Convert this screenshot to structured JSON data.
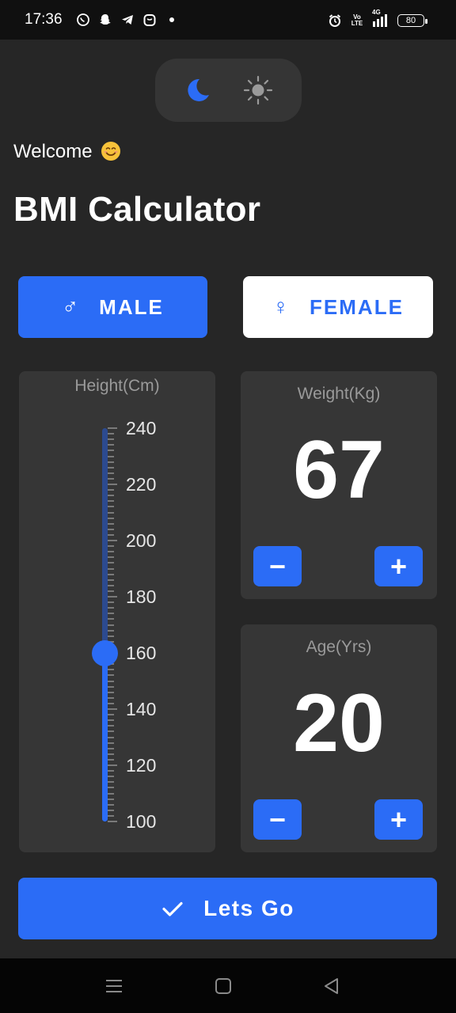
{
  "status_bar": {
    "time": "17:36",
    "left_icons": [
      "whatsapp-icon",
      "snapchat-icon",
      "telegram-icon",
      "bag-icon",
      "dot-icon"
    ],
    "volte": "Vo LTE",
    "network": "4G",
    "battery": "80"
  },
  "theme_toggle": {
    "moon_icon": "moon-icon",
    "sun_icon": "sun-icon",
    "active": "dark"
  },
  "welcome": "Welcome",
  "title": "BMI Calculator",
  "gender": {
    "male_label": "MALE",
    "female_label": "FEMALE",
    "male_symbol": "♂",
    "female_symbol": "♀",
    "selected": "male"
  },
  "height": {
    "label": "Height(Cm)",
    "min": 100,
    "max": 240,
    "value": 160,
    "tick_labels": [
      "240",
      "220",
      "200",
      "180",
      "160",
      "140",
      "120",
      "100"
    ]
  },
  "weight": {
    "label": "Weight(Kg)",
    "value": "67",
    "minus": "−",
    "plus": "+"
  },
  "age": {
    "label": "Age(Yrs)",
    "value": "20",
    "minus": "−",
    "plus": "+"
  },
  "submit": {
    "label": "Lets Go"
  },
  "nav": {
    "icons": [
      "menu-icon",
      "home-icon",
      "back-icon"
    ]
  },
  "colors": {
    "accent": "#2b6cf6",
    "background": "#262626",
    "card": "#363636"
  }
}
